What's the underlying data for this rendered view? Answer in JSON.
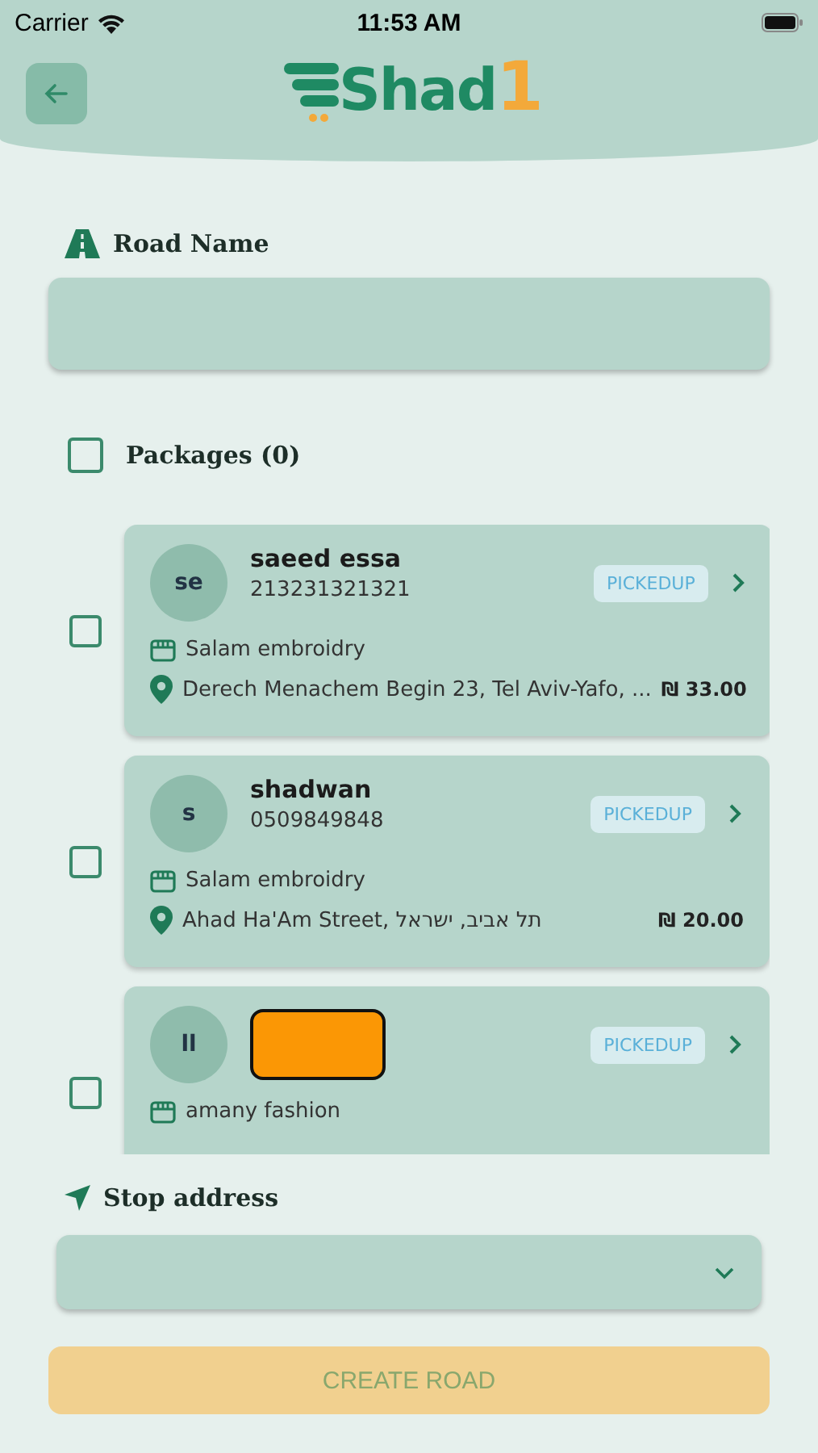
{
  "status_bar": {
    "carrier": "Carrier",
    "time": "11:53 AM"
  },
  "header": {
    "logo_text": "Shad",
    "logo_accent": "1"
  },
  "road_name": {
    "label": "Road Name"
  },
  "packages": {
    "label": "Packages (0)",
    "checked": false
  },
  "orders": [
    {
      "initials": "se",
      "name": "saeed essa",
      "phone": "213231321321",
      "status": "PICKEDUP",
      "store": "Salam embroidry",
      "address": "Derech Menachem Begin 23, Tel Aviv-Yafo, ...",
      "price": "₪ 33.00",
      "checked": false,
      "redacted": false
    },
    {
      "initials": "s",
      "name": "shadwan",
      "phone": "0509849848",
      "status": "PICKEDUP",
      "store": "Salam embroidry",
      "address": "Ahad Ha'Am Street, תל אביב, ישראל",
      "price": "₪ 20.00",
      "checked": false,
      "redacted": false
    },
    {
      "initials": "ll",
      "status": "PICKEDUP",
      "store": "amany fashion",
      "checked": false,
      "redacted": true
    }
  ],
  "stop_address": {
    "label": "Stop address"
  },
  "create_button": {
    "label": "CREATE ROAD",
    "disabled": true
  }
}
